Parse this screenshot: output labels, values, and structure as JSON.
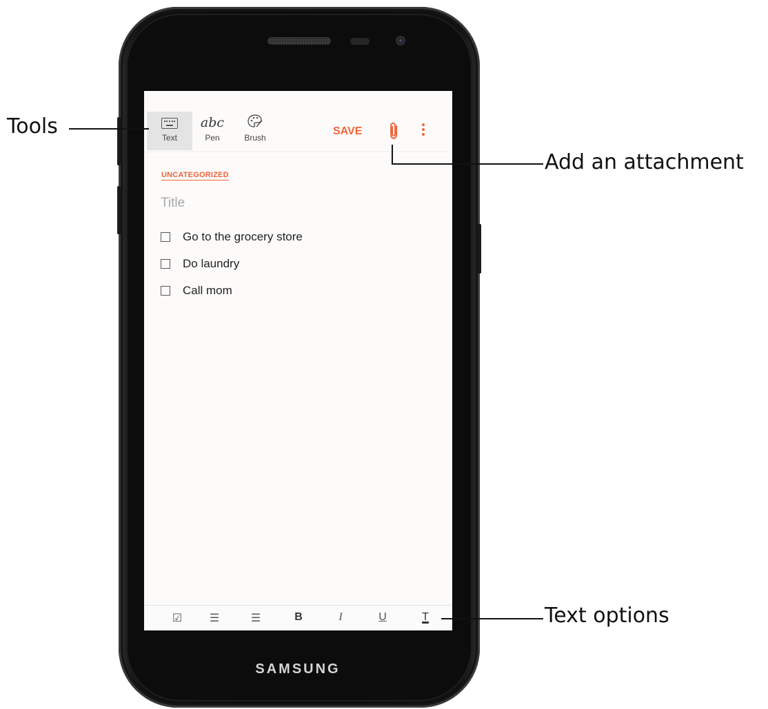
{
  "device": {
    "brand": "SAMSUNG"
  },
  "toolbar": {
    "tools": [
      {
        "label": "Text",
        "icon": "keyboard-icon",
        "active": true
      },
      {
        "label": "Pen",
        "icon_text": "abc",
        "icon": "pen-handwriting-icon"
      },
      {
        "label": "Brush",
        "icon": "palette-icon"
      }
    ],
    "save_label": "SAVE",
    "attach_icon": "paperclip-icon",
    "more_icon": "more-vert-icon",
    "accent_color": "#f0633a"
  },
  "note": {
    "category": "UNCATEGORIZED",
    "title_placeholder": "Title",
    "checklist": [
      {
        "text": "Go to the grocery store",
        "checked": false
      },
      {
        "text": "Do laundry",
        "checked": false
      },
      {
        "text": "Call mom",
        "checked": false
      }
    ]
  },
  "text_options": [
    {
      "icon": "checkbox-icon",
      "glyph": "☑"
    },
    {
      "icon": "numbered-list-icon",
      "glyph": "☰"
    },
    {
      "icon": "bullet-list-icon",
      "glyph": "☰"
    },
    {
      "icon": "bold-icon",
      "glyph": "B"
    },
    {
      "icon": "italic-icon",
      "glyph": "I"
    },
    {
      "icon": "underline-icon",
      "glyph": "U"
    },
    {
      "icon": "text-color-icon",
      "glyph": "T"
    }
  ],
  "callouts": {
    "tools": "Tools",
    "attachment": "Add an attachment",
    "text_options": "Text options"
  }
}
